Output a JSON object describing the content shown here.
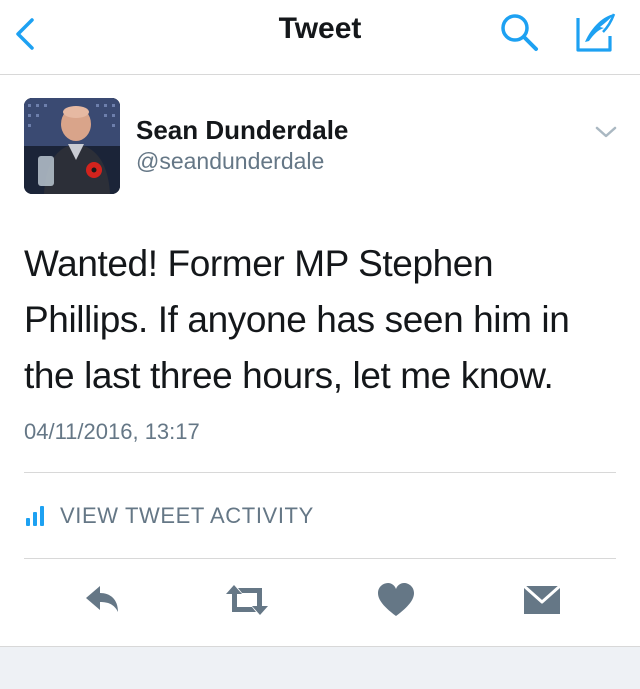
{
  "navbar": {
    "title": "Tweet",
    "back_icon": "chevron-left-icon",
    "search_icon": "search-icon",
    "compose_icon": "compose-quill-icon"
  },
  "tweet": {
    "author_name": "Sean Dunderdale",
    "author_handle": "@seandunderdale",
    "text": "Wanted! Former MP Stephen Phillips. If anyone has seen him in the last three hours, let me know.",
    "timestamp": "04/11/2016, 13:17"
  },
  "activity": {
    "label": "VIEW TWEET ACTIVITY",
    "icon": "bar-chart-icon"
  },
  "actions": {
    "reply_icon": "reply-icon",
    "retweet_icon": "retweet-icon",
    "like_icon": "heart-icon",
    "dm_icon": "envelope-icon"
  },
  "colors": {
    "accent": "#1da1f2",
    "text_primary": "#14171a",
    "text_secondary": "#657786",
    "icon_gray": "#657786",
    "divider": "#d8d8d8",
    "bottom_strip": "#eef1f5"
  }
}
